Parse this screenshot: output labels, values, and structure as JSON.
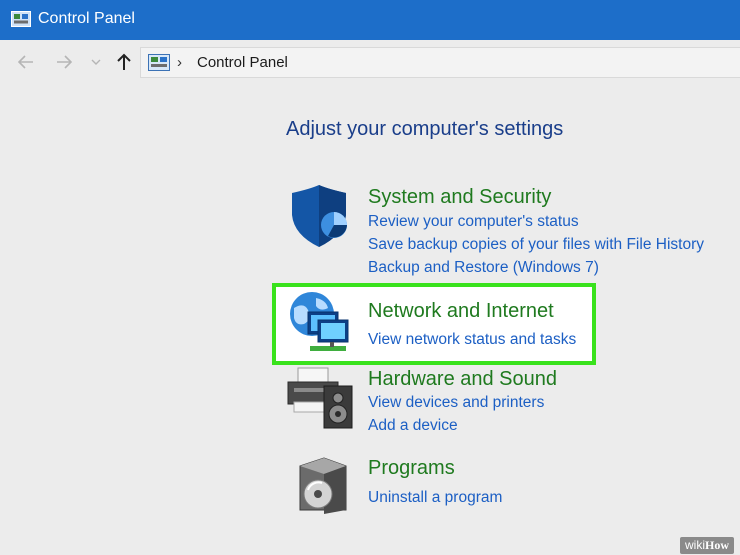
{
  "window": {
    "title": "Control Panel"
  },
  "nav": {
    "back_glyph": "←",
    "forward_glyph": "→",
    "dropdown_glyph": "⌄",
    "up_glyph": "↑"
  },
  "address_bar": {
    "separator": "›",
    "location": "Control Panel"
  },
  "main": {
    "heading": "Adjust your computer's settings"
  },
  "categories": [
    {
      "title": "System and Security",
      "icon": "shield-icon",
      "links": [
        "Review your computer's status",
        "Save backup copies of your files with File History",
        "Backup and Restore (Windows 7)"
      ]
    },
    {
      "title": "Network and Internet",
      "icon": "network-globe-icon",
      "highlighted": true,
      "links": [
        "View network status and tasks"
      ]
    },
    {
      "title": "Hardware and Sound",
      "icon": "printer-speaker-icon",
      "links": [
        "View devices and printers",
        "Add a device"
      ]
    },
    {
      "title": "Programs",
      "icon": "programs-disc-icon",
      "links": [
        "Uninstall a program"
      ]
    }
  ],
  "watermark": {
    "prefix": "wiki",
    "suffix": "How"
  },
  "colors": {
    "titlebar": "#1d6ec9",
    "category_title": "#1f7a1f",
    "link": "#1c5fc4",
    "heading": "#1a3e8a",
    "highlight_border": "#39e21c"
  }
}
